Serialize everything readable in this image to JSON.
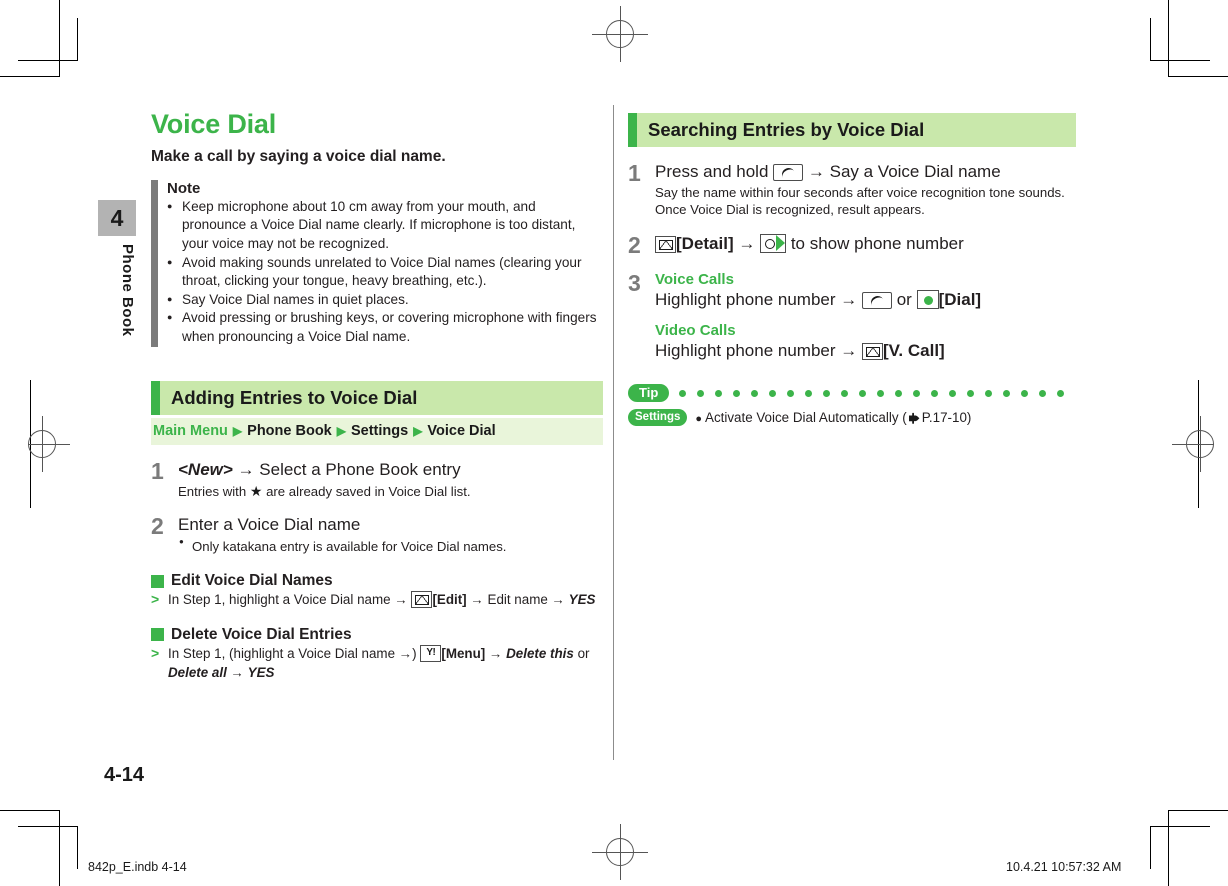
{
  "chapter": {
    "number": "4",
    "name": "Phone Book"
  },
  "left_column": {
    "title": "Voice Dial",
    "subtitle": "Make a call by saying a voice dial name.",
    "note": {
      "heading": "Note",
      "items": [
        "Keep microphone about 10 cm away from your mouth, and pronounce a Voice Dial name clearly. If microphone is too distant, your voice may not be recognized.",
        "Avoid making sounds unrelated to Voice Dial names (clearing your throat, clicking your tongue, heavy breathing, etc.).",
        "Say Voice Dial names in quiet places.",
        "Avoid pressing or brushing keys, or covering microphone with fingers when pronouncing a Voice Dial name."
      ]
    },
    "section_heading": "Adding Entries to Voice Dial",
    "breadcrumb": {
      "first": "Main Menu",
      "items": [
        "Phone Book",
        "Settings",
        "Voice Dial"
      ],
      "arrow": "▶"
    },
    "steps": [
      {
        "number": "1",
        "main_pre": "<New>",
        "main_post": "Select a Phone Book entry",
        "sub_pre": "Entries with",
        "sub_post": "are already saved in Voice Dial list."
      },
      {
        "number": "2",
        "main": "Enter a Voice Dial name",
        "bullet": "Only katakana entry is available for Voice Dial names."
      }
    ],
    "subsections": [
      {
        "title": "Edit Voice Dial Names",
        "prefix": "In Step 1, highlight a Voice Dial name",
        "key_label": "[Edit]",
        "middle": "Edit name",
        "end": "YES"
      },
      {
        "title": "Delete Voice Dial Entries",
        "prefix": "In Step 1, (highlight a Voice Dial name",
        "key_label": "[Menu]",
        "middle": "Delete this",
        "or_word": "or",
        "alt": "Delete all",
        "end": "YES"
      }
    ]
  },
  "right_column": {
    "section_heading": "Searching Entries by Voice Dial",
    "steps": [
      {
        "number": "1",
        "main_pre": "Press and hold",
        "main_post": "Say a Voice Dial name",
        "sub_line1": "Say the name within four seconds after voice recognition tone sounds.",
        "sub_line2": "Once Voice Dial is recognized, result appears."
      },
      {
        "number": "2",
        "key_label": "[Detail]",
        "main_post": "to show phone number"
      },
      {
        "number": "3",
        "voice_heading": "Voice Calls",
        "voice_text": "Highlight phone number",
        "voice_or": "or",
        "voice_key_label": "[Dial]",
        "video_heading": "Video Calls",
        "video_text": "Highlight phone number",
        "video_key_label": "[V. Call]"
      }
    ],
    "tip": {
      "label": "Tip",
      "settings_label": "Settings",
      "item_text": "Activate Voice Dial Automatically (",
      "ref": "P.17-10",
      "close": ")"
    }
  },
  "footer": {
    "page_number": "4-14",
    "file_info": "842p_E.indb   4-14",
    "print_info": "10.4.21   10:57:32 AM"
  },
  "icons": {
    "mail_key": "mail-key-icon",
    "call_key": "call-key-icon",
    "nav_key": "navigation-key-icon",
    "center_key": "center-select-key-icon",
    "menu_key": "yahoo-menu-key-icon",
    "star": "★",
    "arrow": "→"
  },
  "colors": {
    "brand_green": "#3cb44a",
    "header_bg": "#c9e8ab",
    "crumb_bg": "#e9f5da",
    "note_bar": "#7b7b7b",
    "tab_gray": "#b3b3b3"
  }
}
